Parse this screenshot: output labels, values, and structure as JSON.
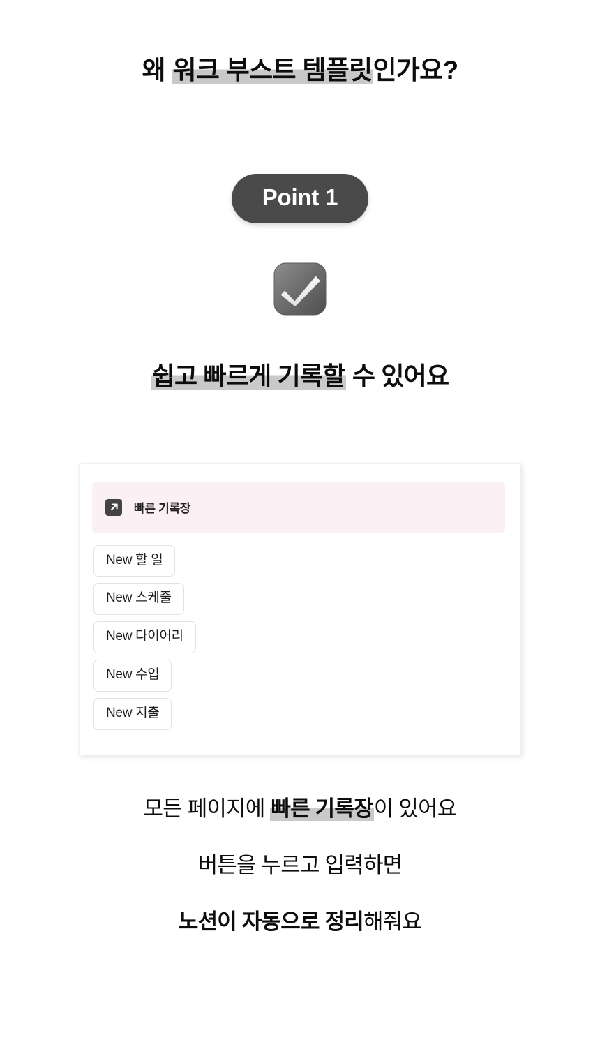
{
  "page": {
    "background_color": "#ffffff",
    "headline": {
      "prefix": "왜 ",
      "highlight": "워크 부스트 템플릿",
      "suffix": "인가요?",
      "highlight_color": "#c9c9c9"
    },
    "badge": {
      "label": "Point 1",
      "background_color": "#4a4a4a",
      "text_color": "#ffffff"
    },
    "icon": {
      "name": "check-mark-button-icon",
      "glyph": "☑️",
      "description": "gray rounded square with white check mark"
    },
    "subheadline": {
      "highlight": "쉽고 빠르게 기록할",
      "suffix": " 수 있어요",
      "highlight_color": "#c9c9c9"
    },
    "card": {
      "quick_note": {
        "icon_name": "arrow-up-right-icon",
        "title": "빠른 기록장",
        "background_color": "#fbf0f3"
      },
      "buttons": [
        {
          "label": "New 할 일"
        },
        {
          "label": "New 스케줄"
        },
        {
          "label": "New 다이어리"
        },
        {
          "label": "New 수입"
        },
        {
          "label": "New 지출"
        }
      ]
    },
    "footer": {
      "line1": {
        "prefix": "모든 페이지에 ",
        "highlight": "빠른 기록장",
        "suffix": "이 있어요"
      },
      "line2": {
        "text": "버튼을 누르고 입력하면"
      },
      "line3": {
        "bold": "노션이 자동으로 정리",
        "regular": "해줘요"
      }
    }
  }
}
